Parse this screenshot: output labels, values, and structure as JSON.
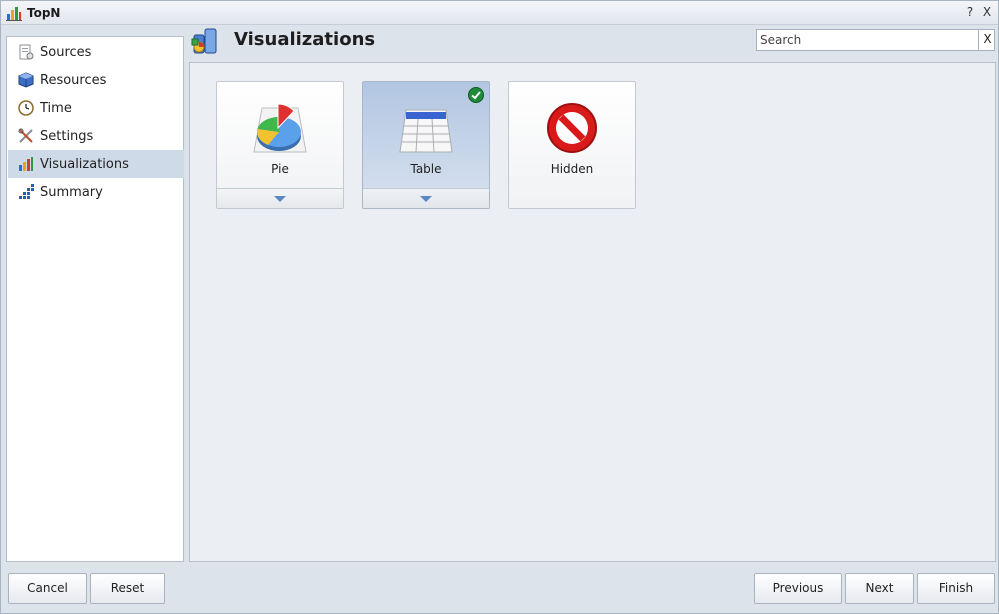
{
  "window": {
    "title": "TopN",
    "help_label": "?",
    "close_label": "X"
  },
  "sidebar": {
    "items": [
      {
        "label": "Sources",
        "icon": "sources-icon"
      },
      {
        "label": "Resources",
        "icon": "resources-icon"
      },
      {
        "label": "Time",
        "icon": "clock-icon"
      },
      {
        "label": "Settings",
        "icon": "settings-icon"
      },
      {
        "label": "Visualizations",
        "icon": "visualizations-icon",
        "selected": true
      },
      {
        "label": "Summary",
        "icon": "summary-icon"
      }
    ]
  },
  "header": {
    "title": "Visualizations"
  },
  "search": {
    "placeholder": "Search",
    "value": "",
    "clear_label": "X"
  },
  "tiles": [
    {
      "label": "Pie",
      "icon": "pie-chart-icon",
      "has_dropdown": true,
      "selected": false
    },
    {
      "label": "Table",
      "icon": "table-icon",
      "has_dropdown": true,
      "selected": true
    },
    {
      "label": "Hidden",
      "icon": "hidden-icon",
      "has_dropdown": false,
      "selected": false
    }
  ],
  "footer": {
    "cancel_label": "Cancel",
    "reset_label": "Reset",
    "previous_label": "Previous",
    "next_label": "Next",
    "finish_label": "Finish"
  },
  "colors": {
    "accent": "#5b87c4",
    "selected_row": "#cfdae8",
    "check_green": "#1f8a3a",
    "stop_red": "#d81a1a"
  }
}
